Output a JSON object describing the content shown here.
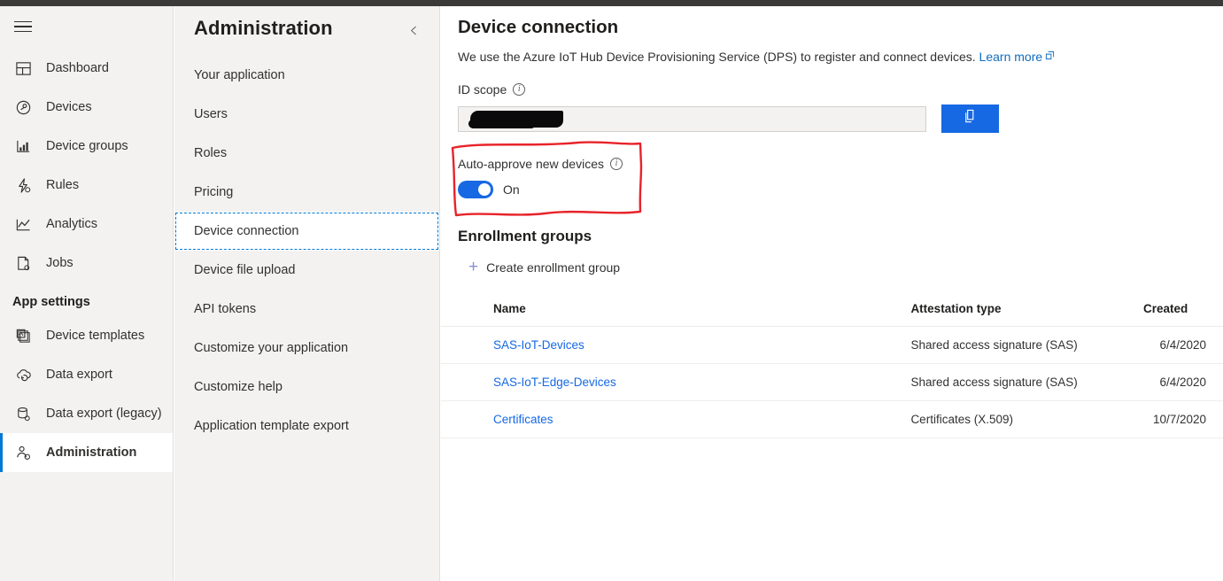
{
  "topbar": {
    "present": true,
    "color": "#3b3a39"
  },
  "leftnav": {
    "menu_icon": "hamburger-icon",
    "items": [
      {
        "label": "Dashboard",
        "icon": "dashboard-icon",
        "selected": false
      },
      {
        "label": "Devices",
        "icon": "devices-icon",
        "selected": false
      },
      {
        "label": "Device groups",
        "icon": "device-groups-icon",
        "selected": false
      },
      {
        "label": "Rules",
        "icon": "rules-icon",
        "selected": false
      },
      {
        "label": "Analytics",
        "icon": "analytics-icon",
        "selected": false
      },
      {
        "label": "Jobs",
        "icon": "jobs-icon",
        "selected": false
      }
    ],
    "section_label": "App settings",
    "settings_items": [
      {
        "label": "Device templates",
        "icon": "device-templates-icon",
        "selected": false
      },
      {
        "label": "Data export",
        "icon": "data-export-icon",
        "selected": false
      },
      {
        "label": "Data export (legacy)",
        "icon": "data-export-legacy-icon",
        "selected": false
      },
      {
        "label": "Administration",
        "icon": "administration-icon",
        "selected": true
      }
    ]
  },
  "subnav": {
    "title": "Administration",
    "collapse_icon": "chevron-left-icon",
    "items": [
      {
        "label": "Your application",
        "active": false
      },
      {
        "label": "Users",
        "active": false
      },
      {
        "label": "Roles",
        "active": false
      },
      {
        "label": "Pricing",
        "active": false
      },
      {
        "label": "Device connection",
        "active": true
      },
      {
        "label": "Device file upload",
        "active": false
      },
      {
        "label": "API tokens",
        "active": false
      },
      {
        "label": "Customize your application",
        "active": false
      },
      {
        "label": "Customize help",
        "active": false
      },
      {
        "label": "Application template export",
        "active": false
      }
    ]
  },
  "main": {
    "title": "Device connection",
    "intro_text": "We use the Azure IoT Hub Device Provisioning Service (DPS) to register and connect devices.",
    "learn_more_label": "Learn more",
    "id_scope": {
      "label": "ID scope",
      "info_icon": "info-icon",
      "value": "",
      "redacted": true,
      "copy_button_icon": "copy-icon"
    },
    "auto_approve": {
      "label": "Auto-approve new devices",
      "info_icon": "info-icon",
      "state_label": "On",
      "checked": true
    },
    "enrollment": {
      "section_title": "Enrollment groups",
      "create_label": "Create enrollment group",
      "create_icon": "plus-icon",
      "columns": [
        "Name",
        "Attestation type",
        "Created"
      ],
      "rows": [
        {
          "name": "SAS-IoT-Devices",
          "attestation": "Shared access signature (SAS)",
          "created": "6/4/2020"
        },
        {
          "name": "SAS-IoT-Edge-Devices",
          "attestation": "Shared access signature (SAS)",
          "created": "6/4/2020"
        },
        {
          "name": "Certificates",
          "attestation": "Certificates (X.509)",
          "created": "10/7/2020"
        }
      ]
    }
  },
  "annotation": {
    "type": "hand-drawn-rectangle",
    "color": "#e8232a"
  },
  "colors": {
    "accent": "#0078d4",
    "button_blue": "#1668e3",
    "link": "#1668e3",
    "nav_bg": "#f3f2f1",
    "topbar": "#3b3a39",
    "annotation_red": "#e8232a"
  }
}
